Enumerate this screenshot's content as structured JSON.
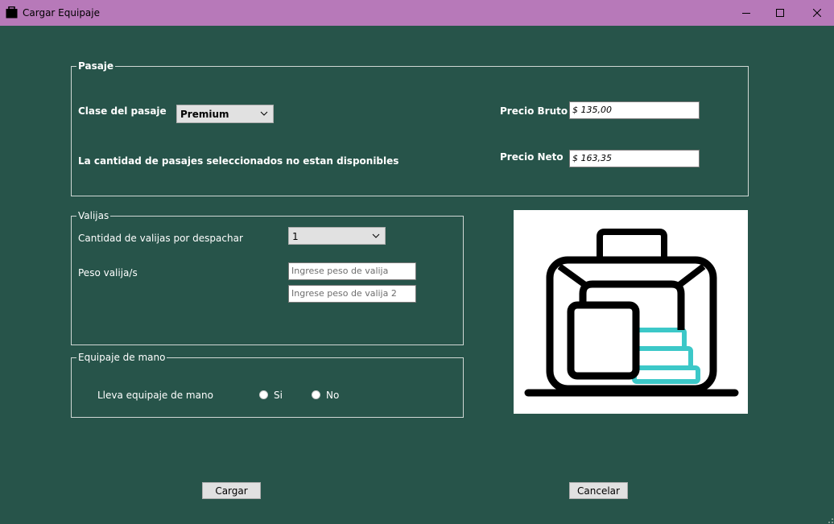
{
  "window": {
    "title": "Cargar Equipaje"
  },
  "pasaje": {
    "legend": "Pasaje",
    "clase_label": "Clase del pasaje",
    "clase_value": "Premium",
    "message": "La cantidad de pasajes seleccionados no estan disponibles",
    "precio_bruto_label": "Precio Bruto",
    "precio_bruto_value": "$ 135,00",
    "precio_neto_label": "Precio Neto",
    "precio_neto_value": "$ 163,35"
  },
  "valijas": {
    "legend": "Valijas",
    "cantidad_label": "Cantidad de valijas por despachar",
    "cantidad_value": "1",
    "peso_label": "Peso valija/s",
    "peso1_placeholder": "Ingrese peso de valija",
    "peso2_placeholder": "Ingrese peso de valija 2"
  },
  "equipaje_mano": {
    "legend": "Equipaje de mano",
    "question": "Lleva equipaje de mano",
    "option_si": "Si",
    "option_no": "No"
  },
  "buttons": {
    "cargar": "Cargar",
    "cancelar": "Cancelar"
  },
  "colors": {
    "background": "#27544a",
    "titlebar": "#b779b9",
    "accent": "#3cc8c8"
  }
}
